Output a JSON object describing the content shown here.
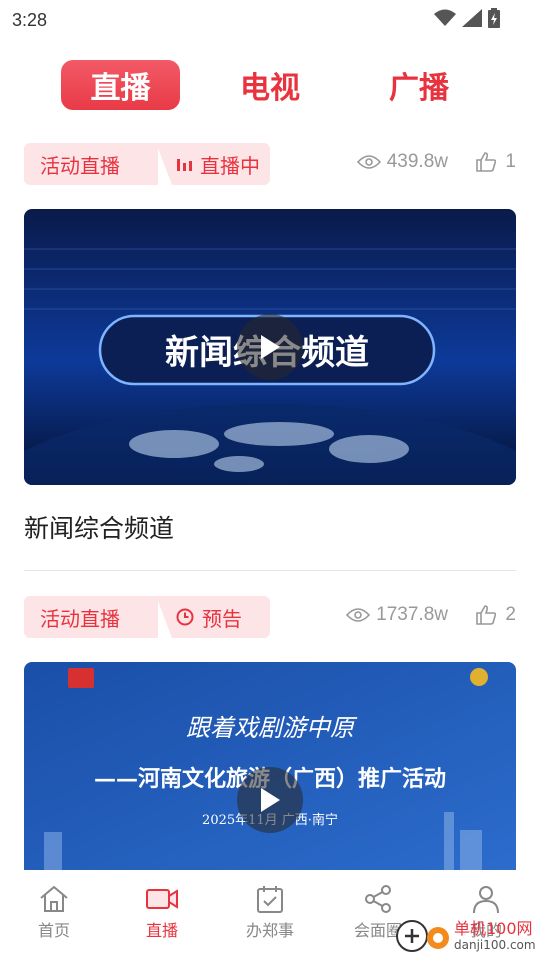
{
  "status_bar": {
    "time": "3:28"
  },
  "top_tabs": [
    {
      "label": "直播",
      "active": true
    },
    {
      "label": "电视",
      "active": false
    },
    {
      "label": "广播",
      "active": false
    }
  ],
  "cards": [
    {
      "category": "活动直播",
      "status": "直播中",
      "status_icon": "bar-chart-icon",
      "views": "439.8w",
      "likes": "1",
      "thumbnail_text": "新闻综合频道",
      "title": "新闻综合频道"
    },
    {
      "category": "活动直播",
      "status": "预告",
      "status_icon": "clock-icon",
      "views": "1737.8w",
      "likes": "2",
      "thumbnail_line1": "跟着戏剧游中原",
      "thumbnail_line2": "——河南文化旅游（广西）推广活动",
      "thumbnail_line3": "2025年11月  广西·南宁"
    }
  ],
  "bottom_nav": [
    {
      "label": "首页",
      "icon": "home-icon",
      "active": false
    },
    {
      "label": "直播",
      "icon": "video-camera-icon",
      "active": true
    },
    {
      "label": "办郑事",
      "icon": "calendar-check-icon",
      "active": false
    },
    {
      "label": "会面圈",
      "icon": "share-icon",
      "active": false
    },
    {
      "label": "我的",
      "icon": "user-icon",
      "active": false
    }
  ],
  "watermark": {
    "name": "单机100网",
    "url": "danji100.com"
  },
  "colors": {
    "accent": "#e8333f",
    "badge_bg": "#fde5e7",
    "muted": "#999999"
  }
}
